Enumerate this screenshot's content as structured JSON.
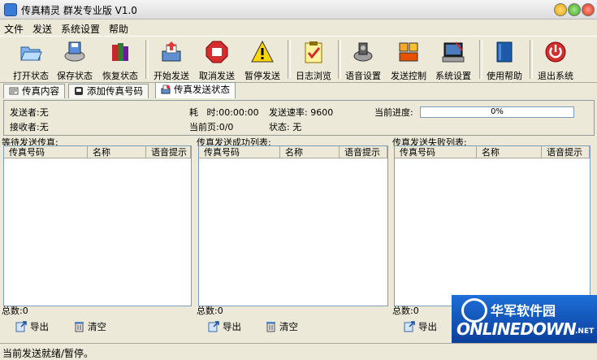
{
  "window": {
    "title": "传真精灵 群发专业版 V1.0"
  },
  "menu": [
    "文件",
    "发送",
    "系统设置",
    "帮助"
  ],
  "toolbar": [
    {
      "label": "打开状态",
      "icon": "folder-open-icon"
    },
    {
      "label": "保存状态",
      "icon": "save-disk-icon"
    },
    {
      "label": "恢复状态",
      "icon": "books-icon"
    },
    {
      "label": "开始发送",
      "icon": "fax-send-icon"
    },
    {
      "label": "取消发送",
      "icon": "stop-sign-icon"
    },
    {
      "label": "暂停发送",
      "icon": "warning-icon"
    },
    {
      "label": "日志浏览",
      "icon": "clipboard-check-icon"
    },
    {
      "label": "语音设置",
      "icon": "speaker-icon"
    },
    {
      "label": "发送控制",
      "icon": "control-panel-icon"
    },
    {
      "label": "系统设置",
      "icon": "computer-settings-icon"
    },
    {
      "label": "使用帮助",
      "icon": "help-book-icon"
    },
    {
      "label": "退出系统",
      "icon": "power-icon"
    }
  ],
  "tabs": [
    "传真内容",
    "添加传真号码",
    "传真发送状态"
  ],
  "status": {
    "sender": "发送者:无",
    "receiver": "接收者:无",
    "elapsed": "耗   时:00:00:00",
    "page": "当前页:0/0",
    "rate": "发送速率: 9600",
    "state": "状态: 无",
    "progress_label": "当前进度:",
    "progress_text": "0%",
    "progress_value": 0
  },
  "panels": [
    {
      "title": "等待发送传真:",
      "count": "总数:0"
    },
    {
      "title": "传真发送成功列表:",
      "count": "总数:0"
    },
    {
      "title": "传真发送失败列表:",
      "count": "总数:0"
    }
  ],
  "columns": [
    "传真号码",
    "名称",
    "语音提示"
  ],
  "buttons": {
    "export": "导出",
    "clear": "清空"
  },
  "statusbar": "当前发送就绪/暂停。",
  "watermark": {
    "cn": "华军软件园",
    "en": "ONLINEDOWN",
    "suffix": ".NET"
  },
  "colors": {
    "accent": "#3c9e3c",
    "face": "#ece9d8",
    "brand": "#1d6fd8"
  }
}
